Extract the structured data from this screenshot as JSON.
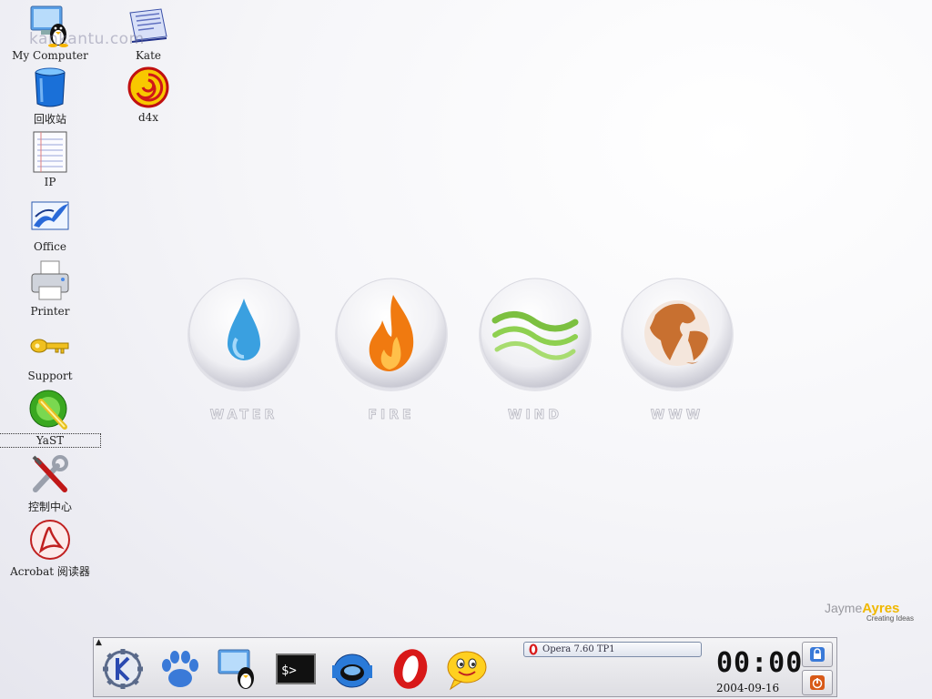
{
  "watermark": "kankantu.com",
  "desktop_icons": [
    {
      "label": "My Computer",
      "icon": "computer-penguin-icon"
    },
    {
      "label": "Kate",
      "icon": "kate-editor-icon"
    },
    {
      "label": "回收站",
      "icon": "trash-bin-icon"
    },
    {
      "label": "d4x",
      "icon": "d4x-download-icon"
    },
    {
      "label": "IP",
      "icon": "notepad-icon"
    },
    {
      "label": "Office",
      "icon": "office-birds-icon"
    },
    {
      "label": "Printer",
      "icon": "printer-icon"
    },
    {
      "label": "Support",
      "icon": "key-icon"
    },
    {
      "label": "YaST",
      "icon": "yast-wrench-icon"
    },
    {
      "label": "控制中心",
      "icon": "tools-icon"
    },
    {
      "label": "Acrobat 阅读器",
      "icon": "acrobat-icon"
    }
  ],
  "elements": [
    {
      "label": "WATER",
      "icon": "water-drop-icon"
    },
    {
      "label": "FIRE",
      "icon": "flame-icon"
    },
    {
      "label": "WIND",
      "icon": "wind-waves-icon"
    },
    {
      "label": "WWW",
      "icon": "globe-icon"
    }
  ],
  "brand": {
    "first": "Jayme",
    "last": "Ayres",
    "tagline": "Creating Ideas"
  },
  "taskbar": {
    "launchers": [
      "kde-menu-icon",
      "paw-icon",
      "computer-penguin-icon",
      "terminal-icon",
      "network-helmet-icon",
      "opera-icon",
      "smiley-chat-icon"
    ],
    "task_button": "Opera 7.60 TP1",
    "clock_time": "00:00",
    "clock_date": "2004-09-16",
    "system_buttons": [
      "lock-icon",
      "logout-icon"
    ]
  },
  "colors": {
    "brand_gold": "#f0b800",
    "water": "#3aa0e0",
    "fire": "#f07a10",
    "wind": "#7cc040",
    "www": "#c87030"
  }
}
